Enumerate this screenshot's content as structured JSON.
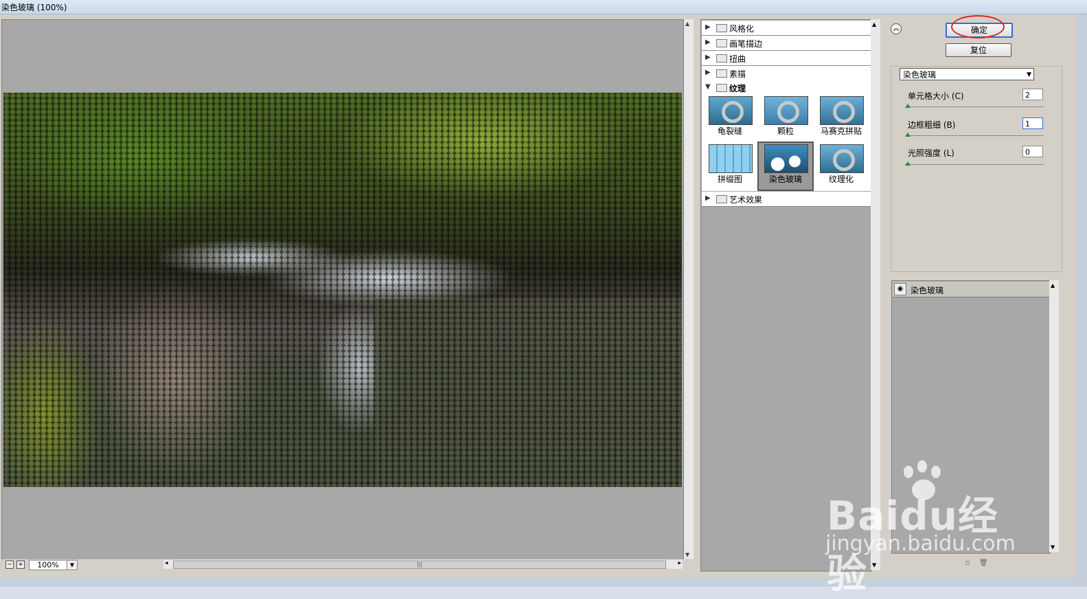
{
  "window": {
    "title": "染色玻璃 (100%)"
  },
  "preview": {
    "zoom": "100%",
    "zoom_minus": "−",
    "zoom_plus": "+"
  },
  "filter_browser": {
    "categories": [
      {
        "label": "风格化",
        "expanded": false
      },
      {
        "label": "画笔描边",
        "expanded": false
      },
      {
        "label": "扭曲",
        "expanded": false
      },
      {
        "label": "素描",
        "expanded": false
      },
      {
        "label": "纹理",
        "expanded": true
      },
      {
        "label": "艺术效果",
        "expanded": false
      }
    ],
    "filters": [
      {
        "label": "龟裂缝"
      },
      {
        "label": "颗粒"
      },
      {
        "label": "马赛克拼贴"
      },
      {
        "label": "拼缀图"
      },
      {
        "label": "染色玻璃",
        "selected": true
      },
      {
        "label": "纹理化"
      }
    ]
  },
  "buttons": {
    "ok": "确定",
    "reset": "复位"
  },
  "settings": {
    "filter_select": "染色玻璃",
    "params": [
      {
        "label": "单元格大小 (C)",
        "value": "2",
        "slider_fraction": 0.0
      },
      {
        "label": "边框粗细 (B)",
        "value": "1",
        "slider_fraction": 0.0
      },
      {
        "label": "光照强度 (L)",
        "value": "0",
        "slider_fraction": 0.0
      }
    ]
  },
  "layers": [
    {
      "label": "染色玻璃",
      "visible": true
    }
  ],
  "watermark": {
    "brand": "Baidu经验",
    "url": "jingyan.baidu.com"
  },
  "colors": {
    "ok_highlight": "#2f6fd0",
    "annotation_ring": "#e2202a",
    "slider_knob": "#2a8a3a"
  }
}
